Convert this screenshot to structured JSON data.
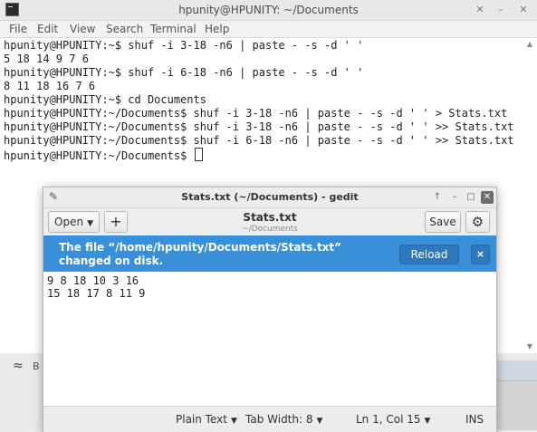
{
  "terminal": {
    "title": "hpunity@HPUNITY: ~/Documents",
    "menu": [
      "File",
      "Edit",
      "View",
      "Search",
      "Terminal",
      "Help"
    ],
    "lines": [
      "hpunity@HPUNITY:~$ shuf -i 3-18 -n6 | paste - -s -d ' '",
      "5 18 14 9 7 6",
      "hpunity@HPUNITY:~$ shuf -i 6-18 -n6 | paste - -s -d ' '",
      "8 11 18 16 7 6",
      "hpunity@HPUNITY:~$ cd Documents",
      "hpunity@HPUNITY:~/Documents$ shuf -i 3-18 -n6 | paste - -s -d ' ' > Stats.txt",
      "hpunity@HPUNITY:~/Documents$ shuf -i 3-18 -n6 | paste - -s -d ' ' >> Stats.txt",
      "hpunity@HPUNITY:~/Documents$ shuf -i 6-18 -n6 | paste - -s -d ' ' >> Stats.txt"
    ],
    "prompt": "hpunity@HPUNITY:~/Documents$ "
  },
  "desktop": {
    "label": "B"
  },
  "gedit": {
    "title": "Stats.txt (~/Documents) - gedit",
    "open_label": "Open",
    "new_tab_label": "+",
    "doc_title": "Stats.txt",
    "doc_path": "~/Documents",
    "save_label": "Save",
    "info_message": "The file “/home/hpunity/Documents/Stats.txt” changed on disk.",
    "reload_label": "Reload",
    "info_close": "×",
    "content_lines": [
      "9 8 18 10 3 16",
      "15 18 17 8 11 9"
    ],
    "status": {
      "language": "Plain Text",
      "tab_width": "Tab Width: 8",
      "position": "Ln 1, Col 15",
      "mode": "INS"
    }
  },
  "colors": {
    "info_bar": "#3a8fd9",
    "reload_button": "#2f78bd"
  }
}
